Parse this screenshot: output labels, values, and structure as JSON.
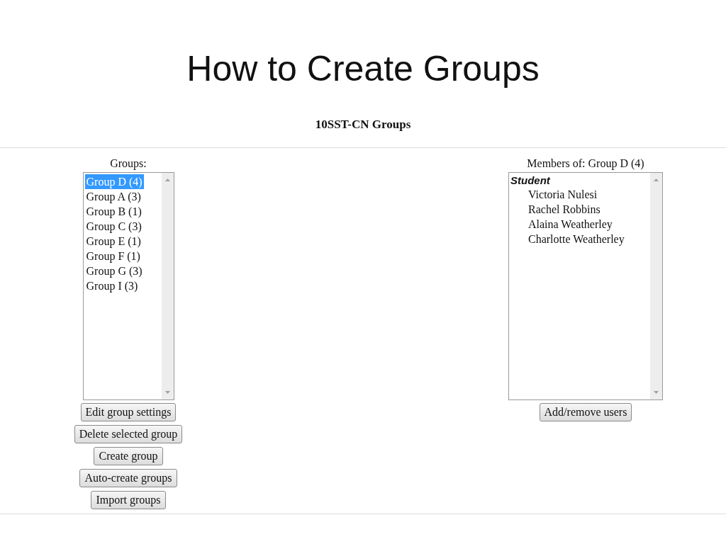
{
  "slide_title": "How to Create Groups",
  "page_heading": "10SST-CN Groups",
  "groups_panel": {
    "label": "Groups:",
    "items": [
      {
        "label": "Group D (4)",
        "selected": true
      },
      {
        "label": "Group A (3)",
        "selected": false
      },
      {
        "label": "Group B (1)",
        "selected": false
      },
      {
        "label": "Group C (3)",
        "selected": false
      },
      {
        "label": "Group E (1)",
        "selected": false
      },
      {
        "label": "Group F (1)",
        "selected": false
      },
      {
        "label": "Group G (3)",
        "selected": false
      },
      {
        "label": "Group I (3)",
        "selected": false
      }
    ],
    "buttons": [
      "Edit group settings",
      "Delete selected group",
      "Create group",
      "Auto-create groups",
      "Import groups"
    ]
  },
  "members_panel": {
    "label": "Members of: Group D (4)",
    "role": "Student",
    "members": [
      "Victoria Nulesi",
      "Rachel Robbins",
      "Alaina Weatherley",
      "Charlotte Weatherley"
    ],
    "buttons": [
      "Add/remove users"
    ]
  }
}
